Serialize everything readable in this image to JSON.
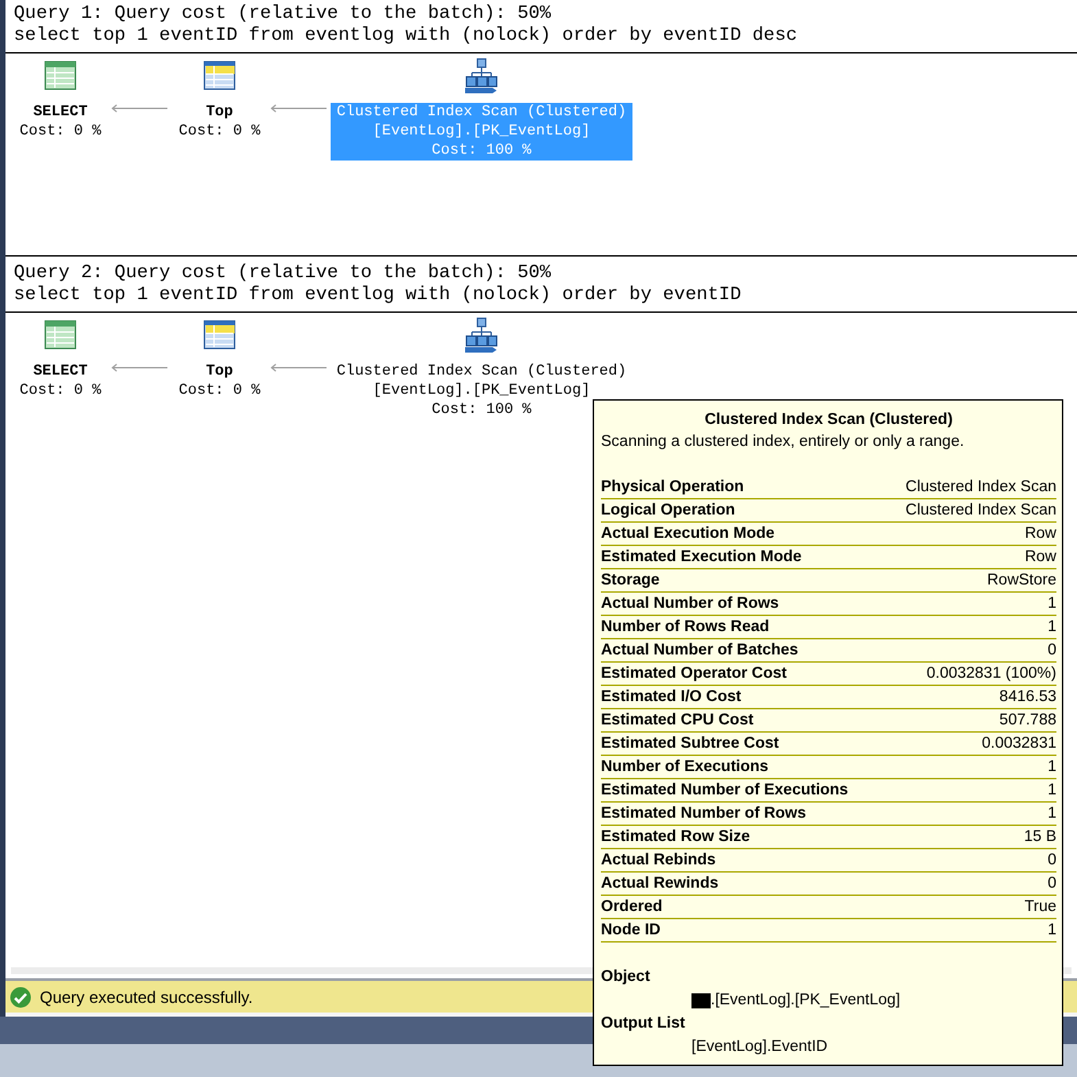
{
  "queries": [
    {
      "header": "Query 1: Query cost (relative to the batch): 50%",
      "sql": "select top 1 eventID from eventlog with (nolock) order by eventID desc",
      "nodes": [
        {
          "kind": "select",
          "label": "SELECT",
          "cost": "Cost: 0 %",
          "selected": false
        },
        {
          "kind": "top",
          "label": "Top",
          "cost": "Cost: 0 %",
          "selected": false
        },
        {
          "kind": "scan",
          "label": "Clustered Index Scan (Clustered)",
          "detail": "[EventLog].[PK_EventLog]",
          "cost": "Cost: 100 %",
          "selected": true
        }
      ]
    },
    {
      "header": "Query 2: Query cost (relative to the batch): 50%",
      "sql": "select top 1 eventID from eventlog with (nolock) order by eventID",
      "nodes": [
        {
          "kind": "select",
          "label": "SELECT",
          "cost": "Cost: 0 %",
          "selected": false
        },
        {
          "kind": "top",
          "label": "Top",
          "cost": "Cost: 0 %",
          "selected": false
        },
        {
          "kind": "scan",
          "label": "Clustered Index Scan (Clustered)",
          "detail": "[EventLog].[PK_EventLog]",
          "cost": "Cost: 100 %",
          "selected": false
        }
      ]
    }
  ],
  "tooltip": {
    "title": "Clustered Index Scan (Clustered)",
    "description": "Scanning a clustered index, entirely or only a range.",
    "rows": [
      {
        "label": "Physical Operation",
        "value": "Clustered Index Scan"
      },
      {
        "label": "Logical Operation",
        "value": "Clustered Index Scan"
      },
      {
        "label": "Actual Execution Mode",
        "value": "Row"
      },
      {
        "label": "Estimated Execution Mode",
        "value": "Row"
      },
      {
        "label": "Storage",
        "value": "RowStore"
      },
      {
        "label": "Actual Number of Rows",
        "value": "1"
      },
      {
        "label": "Number of Rows Read",
        "value": "1"
      },
      {
        "label": "Actual Number of Batches",
        "value": "0"
      },
      {
        "label": "Estimated Operator Cost",
        "value": "0.0032831 (100%)"
      },
      {
        "label": "Estimated I/O Cost",
        "value": "8416.53"
      },
      {
        "label": "Estimated CPU Cost",
        "value": "507.788"
      },
      {
        "label": "Estimated Subtree Cost",
        "value": "0.0032831"
      },
      {
        "label": "Number of Executions",
        "value": "1"
      },
      {
        "label": "Estimated Number of Executions",
        "value": "1"
      },
      {
        "label": "Estimated Number of Rows",
        "value": "1"
      },
      {
        "label": "Estimated Row Size",
        "value": "15 B"
      },
      {
        "label": "Actual Rebinds",
        "value": "0"
      },
      {
        "label": "Actual Rewinds",
        "value": "0"
      },
      {
        "label": "Ordered",
        "value": "True"
      },
      {
        "label": "Node ID",
        "value": "1"
      }
    ],
    "sections": [
      {
        "label": "Object",
        "value": ".[EventLog].[PK_EventLog]",
        "redacted": true
      },
      {
        "label": "Output List",
        "value": "[EventLog].EventID",
        "redacted": false
      }
    ]
  },
  "status": {
    "message": "Query executed successfully.",
    "success": true
  }
}
